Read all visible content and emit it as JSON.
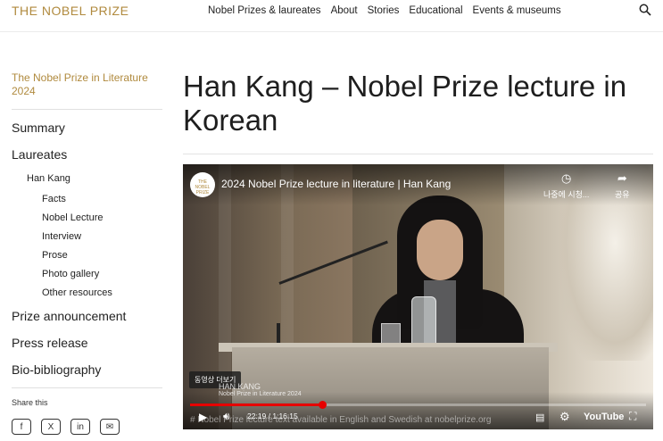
{
  "header": {
    "logo": "THE NOBEL PRIZE",
    "nav": [
      "Nobel Prizes & laureates",
      "About",
      "Stories",
      "Educational",
      "Events & museums"
    ]
  },
  "sidebar": {
    "title": "The Nobel Prize in Literature 2024",
    "items": [
      {
        "label": "Summary",
        "level": 1
      },
      {
        "label": "Laureates",
        "level": 1
      },
      {
        "label": "Han Kang",
        "level": 2
      },
      {
        "label": "Facts",
        "level": 3
      },
      {
        "label": "Nobel Lecture",
        "level": 3
      },
      {
        "label": "Interview",
        "level": 3
      },
      {
        "label": "Prose",
        "level": 3
      },
      {
        "label": "Photo gallery",
        "level": 3
      },
      {
        "label": "Other resources",
        "level": 3
      },
      {
        "label": "Prize announcement",
        "level": 1
      },
      {
        "label": "Press release",
        "level": 1
      },
      {
        "label": "Bio-bibliography",
        "level": 1
      }
    ],
    "share_label": "Share this",
    "share_icons": [
      "facebook-icon",
      "x-icon",
      "linkedin-icon",
      "email-icon"
    ]
  },
  "main": {
    "title": "Han Kang – Nobel Prize lecture in Korean"
  },
  "video": {
    "logo_text": "THE NOBEL PRIZE",
    "title": "2024 Nobel Prize lecture in literature | Han Kang",
    "watch_later": "나중에 시청...",
    "share": "공유",
    "more_videos": "동영상 더보기",
    "caption_name": "HAN KANG",
    "caption_prize": "Nobel Prize in Literature 2024",
    "time": "22:19 / 1:16:15",
    "progress": 0.29,
    "description": "# Nobel Prize lecture text available in English and Swedish at nobelprize.org",
    "youtube": "YouTube"
  }
}
